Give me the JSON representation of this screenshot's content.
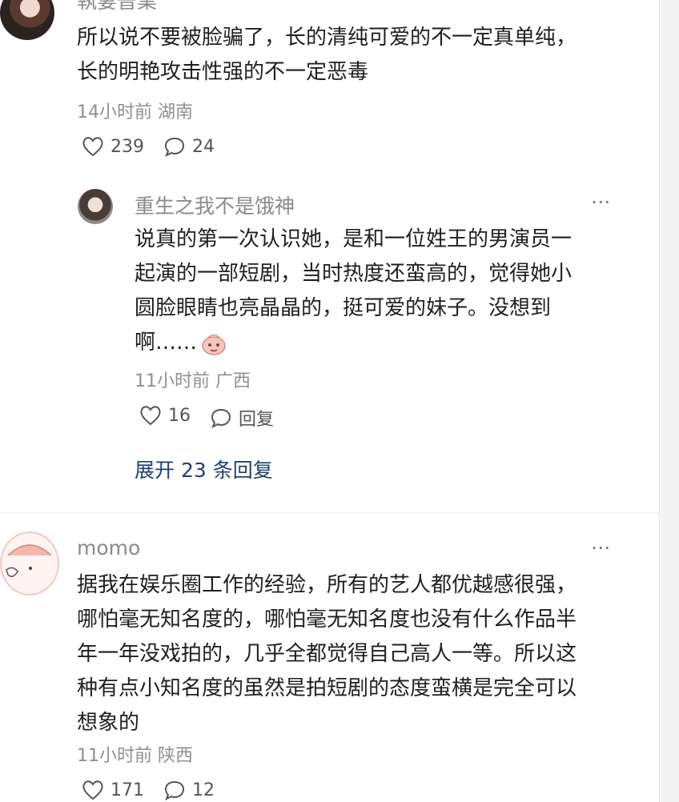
{
  "comment1": {
    "author": "執妻晉業",
    "lines": [
      "所以说不要被脸骗了，长的清纯可爱的不一定真单纯，",
      "长的明艳攻击性强的不一定恶毒"
    ],
    "meta": "14小时前 湖南",
    "likes": "239",
    "comments": "24"
  },
  "reply1": {
    "author": "重生之我不是饿神",
    "lines": [
      "说真的第一次认识她，是和一位姓王的男演员一",
      "起演的一部短剧，当时热度还蛮高的，觉得她小",
      "圆脸眼睛也亮晶晶的，挺可爱的妹子。没想到",
      "啊……"
    ],
    "meta": "11小时前 广西",
    "likes": "16",
    "reply_label": "回复"
  },
  "expand_replies": "展开 23 条回复",
  "comment2": {
    "author": "momo",
    "lines": [
      "据我在娱乐圈工作的经验，所有的艺人都优越感很强，",
      "哪怕毫无知名度的，哪怕毫无知名度也没有什么作品半",
      "年一年没戏拍的，几乎全都觉得自己高人一等。所以这",
      "种有点小知名度的虽然是拍短剧的态度蛮横是完全可以",
      "想象的"
    ],
    "meta": "11小时前 陕西",
    "likes": "171",
    "comments": "12"
  },
  "more_label": "⋯",
  "colors": {
    "link": "#1f3f74",
    "meta": "#8f8f8f",
    "text": "#1f1f1f"
  },
  "icons": {
    "like": "heart-outline-icon",
    "comment": "speech-bubble-icon",
    "emoji": "sticker-emoji-icon"
  }
}
